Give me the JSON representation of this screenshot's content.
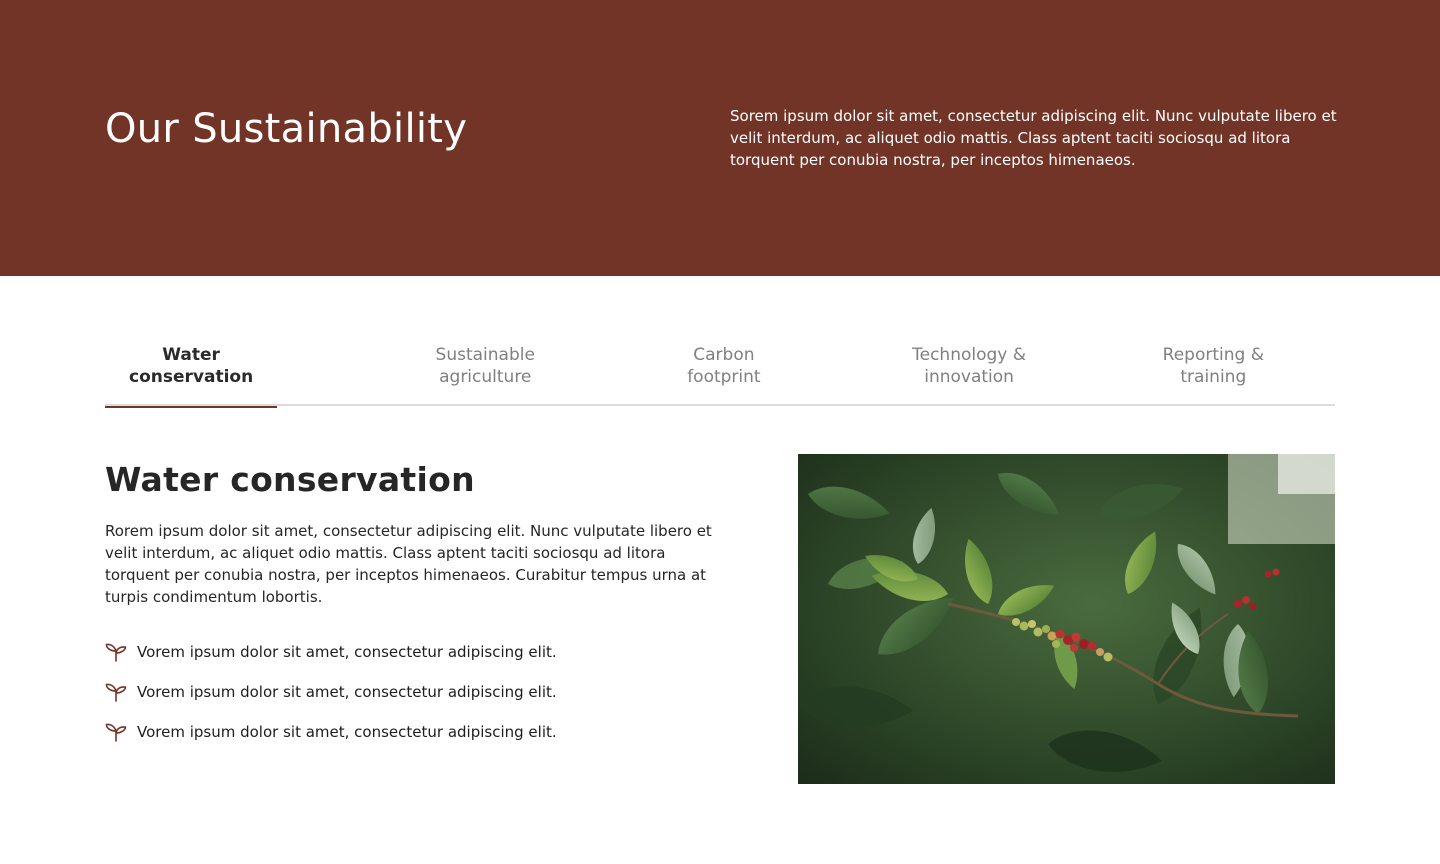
{
  "hero": {
    "title": "Our Sustainability",
    "description": "Sorem ipsum dolor sit amet, consectetur adipiscing elit. Nunc vulputate libero et velit interdum, ac aliquet odio mattis. Class aptent taciti sociosqu ad litora torquent per conubia nostra, per inceptos himenaeos.",
    "background_color": "#723427"
  },
  "tabs": [
    {
      "label": "Water conservation",
      "active": true
    },
    {
      "label": "Sustainable agriculture",
      "active": false
    },
    {
      "label": "Carbon footprint",
      "active": false
    },
    {
      "label": "Technology & innovation",
      "active": false
    },
    {
      "label": "Reporting & training",
      "active": false
    }
  ],
  "content": {
    "title": "Water conservation",
    "body": "Rorem ipsum dolor sit amet, consectetur adipiscing elit. Nunc vulputate libero et velit interdum, ac aliquet odio mattis. Class aptent taciti sociosqu ad litora torquent per conubia nostra, per inceptos himenaeos. Curabitur tempus urna at turpis condimentum lobortis.",
    "bullets": [
      {
        "icon": "sprout-icon",
        "text": "Vorem ipsum dolor sit amet, consectetur adipiscing elit."
      },
      {
        "icon": "sprout-icon",
        "text": "Vorem ipsum dolor sit amet, consectetur adipiscing elit."
      },
      {
        "icon": "sprout-icon",
        "text": "Vorem ipsum dolor sit amet, consectetur adipiscing elit."
      }
    ]
  },
  "colors": {
    "accent": "#723427",
    "tab_inactive": "#808080",
    "tab_active": "#2b2b2b"
  }
}
